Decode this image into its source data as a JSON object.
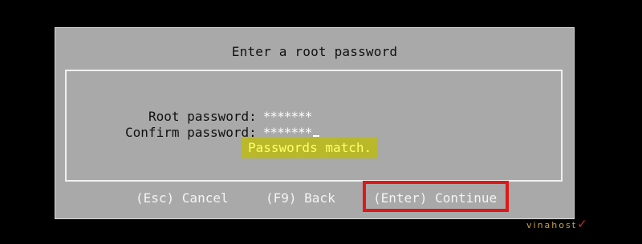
{
  "dialog": {
    "title": "Enter a root password",
    "fields": [
      {
        "label": "Root password:",
        "value": "*******"
      },
      {
        "label": "Confirm password:",
        "value": "*******"
      }
    ],
    "status_message": "Passwords match.",
    "actions": {
      "cancel": "(Esc) Cancel",
      "back": "(F9) Back",
      "continue": "(Enter) Continue"
    }
  },
  "watermark": {
    "text": "vinahost",
    "mark": "✓"
  },
  "colors": {
    "background": "#000000",
    "dialog": "#a9a9a9",
    "status_bg": "#b8b82a",
    "status_text": "#ffff6a",
    "annotation": "#e01818"
  }
}
